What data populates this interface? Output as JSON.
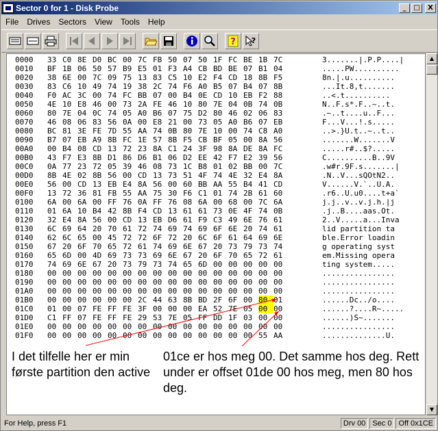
{
  "window": {
    "title": "Sector 0 for 1 - Disk Probe",
    "controls": {
      "minimize": "_",
      "maximize": "□",
      "close": "X"
    }
  },
  "menu": [
    "File",
    "Drives",
    "Sectors",
    "View",
    "Tools",
    "Help"
  ],
  "toolbar": {
    "buttons": [
      {
        "name": "read-sector-icon"
      },
      {
        "name": "write-sector-icon"
      },
      {
        "name": "print-icon"
      },
      {
        "name": "first-sector-icon"
      },
      {
        "name": "previous-sector-icon"
      },
      {
        "name": "next-sector-icon"
      },
      {
        "name": "last-sector-icon"
      },
      {
        "name": "open-icon"
      },
      {
        "name": "save-icon"
      },
      {
        "name": "info-icon"
      },
      {
        "name": "find-icon"
      },
      {
        "name": "help-icon"
      },
      {
        "name": "context-help-icon"
      }
    ]
  },
  "hex_rows": [
    {
      "offset": "0000",
      "bytes": [
        "33",
        "C0",
        "8E",
        "D0",
        "BC",
        "00",
        "7C",
        "FB",
        "50",
        "07",
        "50",
        "1F",
        "FC",
        "BE",
        "1B",
        "7C"
      ],
      "ascii": "3.......|.P.P....|"
    },
    {
      "offset": "0010",
      "bytes": [
        "BF",
        "1B",
        "06",
        "50",
        "57",
        "B9",
        "E5",
        "01",
        "F3",
        "A4",
        "CB",
        "BD",
        "BE",
        "07",
        "B1",
        "04"
      ],
      "ascii": ".....PW.........."
    },
    {
      "offset": "0020",
      "bytes": [
        "38",
        "6E",
        "00",
        "7C",
        "09",
        "75",
        "13",
        "83",
        "C5",
        "10",
        "E2",
        "F4",
        "CD",
        "18",
        "8B",
        "F5"
      ],
      "ascii": "8n.|.u.........."
    },
    {
      "offset": "0030",
      "bytes": [
        "83",
        "C6",
        "10",
        "49",
        "74",
        "19",
        "38",
        "2C",
        "74",
        "F6",
        "A0",
        "B5",
        "07",
        "B4",
        "07",
        "8B"
      ],
      "ascii": "...It.8,t......."
    },
    {
      "offset": "0040",
      "bytes": [
        "F0",
        "AC",
        "3C",
        "00",
        "74",
        "FC",
        "BB",
        "07",
        "00",
        "B4",
        "0E",
        "CD",
        "10",
        "EB",
        "F2",
        "88"
      ],
      "ascii": "..<.t.........."
    },
    {
      "offset": "0050",
      "bytes": [
        "4E",
        "10",
        "E8",
        "46",
        "00",
        "73",
        "2A",
        "FE",
        "46",
        "10",
        "80",
        "7E",
        "04",
        "0B",
        "74",
        "0B"
      ],
      "ascii": "N..F.s*.F..~..t."
    },
    {
      "offset": "0060",
      "bytes": [
        "80",
        "7E",
        "04",
        "0C",
        "74",
        "05",
        "A0",
        "B6",
        "07",
        "75",
        "D2",
        "80",
        "46",
        "02",
        "06",
        "83"
      ],
      "ascii": ".~..t....u..F..."
    },
    {
      "offset": "0070",
      "bytes": [
        "46",
        "08",
        "06",
        "83",
        "56",
        "0A",
        "00",
        "E8",
        "21",
        "00",
        "73",
        "05",
        "A0",
        "B6",
        "07",
        "EB"
      ],
      "ascii": "F...V...!.s....."
    },
    {
      "offset": "0080",
      "bytes": [
        "BC",
        "81",
        "3E",
        "FE",
        "7D",
        "55",
        "AA",
        "74",
        "0B",
        "80",
        "7E",
        "10",
        "00",
        "74",
        "C8",
        "A0"
      ],
      "ascii": "..>.}U.t..~..t.."
    },
    {
      "offset": "0090",
      "bytes": [
        "B7",
        "07",
        "EB",
        "A9",
        "8B",
        "FC",
        "1E",
        "57",
        "8B",
        "F5",
        "CB",
        "BF",
        "05",
        "00",
        "8A",
        "56"
      ],
      "ascii": ".......W.......V"
    },
    {
      "offset": "00A0",
      "bytes": [
        "00",
        "B4",
        "08",
        "CD",
        "13",
        "72",
        "23",
        "8A",
        "C1",
        "24",
        "3F",
        "98",
        "8A",
        "DE",
        "8A",
        "FC"
      ],
      "ascii": ".....r#..$?....."
    },
    {
      "offset": "00B0",
      "bytes": [
        "43",
        "F7",
        "E3",
        "8B",
        "D1",
        "86",
        "D6",
        "B1",
        "06",
        "D2",
        "EE",
        "42",
        "F7",
        "E2",
        "39",
        "56"
      ],
      "ascii": "C..........B..9V"
    },
    {
      "offset": "00C0",
      "bytes": [
        "0A",
        "77",
        "23",
        "72",
        "05",
        "39",
        "46",
        "08",
        "73",
        "1C",
        "B8",
        "01",
        "02",
        "BB",
        "00",
        "7C"
      ],
      "ascii": ".w#r.9F.s.......|"
    },
    {
      "offset": "00D0",
      "bytes": [
        "8B",
        "4E",
        "02",
        "8B",
        "56",
        "00",
        "CD",
        "13",
        "73",
        "51",
        "4F",
        "74",
        "4E",
        "32",
        "E4",
        "8A"
      ],
      "ascii": ".N..V...sQOtN2.."
    },
    {
      "offset": "00E0",
      "bytes": [
        "56",
        "00",
        "CD",
        "13",
        "EB",
        "E4",
        "8A",
        "56",
        "00",
        "60",
        "BB",
        "AA",
        "55",
        "B4",
        "41",
        "CD"
      ],
      "ascii": "V......V.`..U.A."
    },
    {
      "offset": "00F0",
      "bytes": [
        "13",
        "72",
        "36",
        "81",
        "FB",
        "55",
        "AA",
        "75",
        "30",
        "F6",
        "C1",
        "01",
        "74",
        "2B",
        "61",
        "60"
      ],
      "ascii": ".r6..U.u0....t+a`"
    },
    {
      "offset": "0100",
      "bytes": [
        "6A",
        "00",
        "6A",
        "00",
        "FF",
        "76",
        "0A",
        "FF",
        "76",
        "08",
        "6A",
        "00",
        "68",
        "00",
        "7C",
        "6A"
      ],
      "ascii": "j.j..v..v.j.h.|j"
    },
    {
      "offset": "0110",
      "bytes": [
        "01",
        "6A",
        "10",
        "B4",
        "42",
        "8B",
        "F4",
        "CD",
        "13",
        "61",
        "61",
        "73",
        "0E",
        "4F",
        "74",
        "0B"
      ],
      "ascii": ".j..B....aas.Ot."
    },
    {
      "offset": "0120",
      "bytes": [
        "32",
        "E4",
        "8A",
        "56",
        "00",
        "CD",
        "13",
        "EB",
        "D6",
        "61",
        "F9",
        "C3",
        "49",
        "6E",
        "76",
        "61"
      ],
      "ascii": "2..V.....a...Inva"
    },
    {
      "offset": "0130",
      "bytes": [
        "6C",
        "69",
        "64",
        "20",
        "70",
        "61",
        "72",
        "74",
        "69",
        "74",
        "69",
        "6F",
        "6E",
        "20",
        "74",
        "61"
      ],
      "ascii": "lid partition ta"
    },
    {
      "offset": "0140",
      "bytes": [
        "62",
        "6C",
        "65",
        "00",
        "45",
        "72",
        "72",
        "6F",
        "72",
        "20",
        "6C",
        "6F",
        "61",
        "64",
        "69",
        "6E"
      ],
      "ascii": "ble.Error loadin"
    },
    {
      "offset": "0150",
      "bytes": [
        "67",
        "20",
        "6F",
        "70",
        "65",
        "72",
        "61",
        "74",
        "69",
        "6E",
        "67",
        "20",
        "73",
        "79",
        "73",
        "74"
      ],
      "ascii": "g operating syst"
    },
    {
      "offset": "0160",
      "bytes": [
        "65",
        "6D",
        "00",
        "4D",
        "69",
        "73",
        "73",
        "69",
        "6E",
        "67",
        "20",
        "6F",
        "70",
        "65",
        "72",
        "61"
      ],
      "ascii": "em.Missing opera"
    },
    {
      "offset": "0170",
      "bytes": [
        "74",
        "69",
        "6E",
        "67",
        "20",
        "73",
        "79",
        "73",
        "74",
        "65",
        "6D",
        "00",
        "00",
        "00",
        "00",
        "00"
      ],
      "ascii": "ting system....."
    },
    {
      "offset": "0180",
      "bytes": [
        "00",
        "00",
        "00",
        "00",
        "00",
        "00",
        "00",
        "00",
        "00",
        "00",
        "00",
        "00",
        "00",
        "00",
        "00",
        "00"
      ],
      "ascii": "................"
    },
    {
      "offset": "0190",
      "bytes": [
        "00",
        "00",
        "00",
        "00",
        "00",
        "00",
        "00",
        "00",
        "00",
        "00",
        "00",
        "00",
        "00",
        "00",
        "00",
        "00"
      ],
      "ascii": "................"
    },
    {
      "offset": "01A0",
      "bytes": [
        "00",
        "00",
        "00",
        "00",
        "00",
        "00",
        "00",
        "00",
        "00",
        "00",
        "00",
        "00",
        "00",
        "00",
        "00",
        "00"
      ],
      "ascii": "................"
    },
    {
      "offset": "01B0",
      "bytes": [
        "00",
        "00",
        "00",
        "00",
        "00",
        "00",
        "2C",
        "44",
        "63",
        "8B",
        "BD",
        "2F",
        "6F",
        "00",
        "80",
        "01"
      ],
      "ascii": "......Dc../o...."
    },
    {
      "offset": "01C0",
      "bytes": [
        "01",
        "00",
        "07",
        "FE",
        "FF",
        "FE",
        "3F",
        "00",
        "00",
        "00",
        "EA",
        "52",
        "7E",
        "05",
        "00",
        "00"
      ],
      "ascii": "......?....R~....."
    },
    {
      "offset": "01D0",
      "bytes": [
        "C1",
        "FF",
        "07",
        "FE",
        "FF",
        "FE",
        "29",
        "53",
        "7E",
        "05",
        "FF",
        "DD",
        "1F",
        "03",
        "00",
        "00"
      ],
      "ascii": "......)S~......."
    },
    {
      "offset": "01E0",
      "bytes": [
        "00",
        "00",
        "00",
        "00",
        "00",
        "00",
        "00",
        "00",
        "00",
        "00",
        "00",
        "00",
        "00",
        "00",
        "00",
        "00"
      ],
      "ascii": "................"
    },
    {
      "offset": "01F0",
      "bytes": [
        "00",
        "00",
        "00",
        "00",
        "00",
        "00",
        "00",
        "00",
        "00",
        "00",
        "00",
        "00",
        "00",
        "00",
        "55",
        "AA"
      ],
      "ascii": "..............U."
    }
  ],
  "highlights": [
    {
      "row": "01B0",
      "col": 14
    },
    {
      "row": "01C0",
      "col": 14
    }
  ],
  "status": {
    "help": "For Help, press F1",
    "drive": "Drv  00",
    "sector": "Sec 0",
    "offset": "Off 0x1CE"
  },
  "annotations": {
    "left": "I det tilfelle her er min første partition den active",
    "right": "01ce er hos meg 00. Det samme hos deg. Rett under er offset 01de 00 hos meg, men 80 hos deg."
  },
  "colors": {
    "title_start": "#0a246a",
    "title_end": "#a6caf0",
    "highlight": "#ffff00",
    "arrow": "#ff0000"
  }
}
